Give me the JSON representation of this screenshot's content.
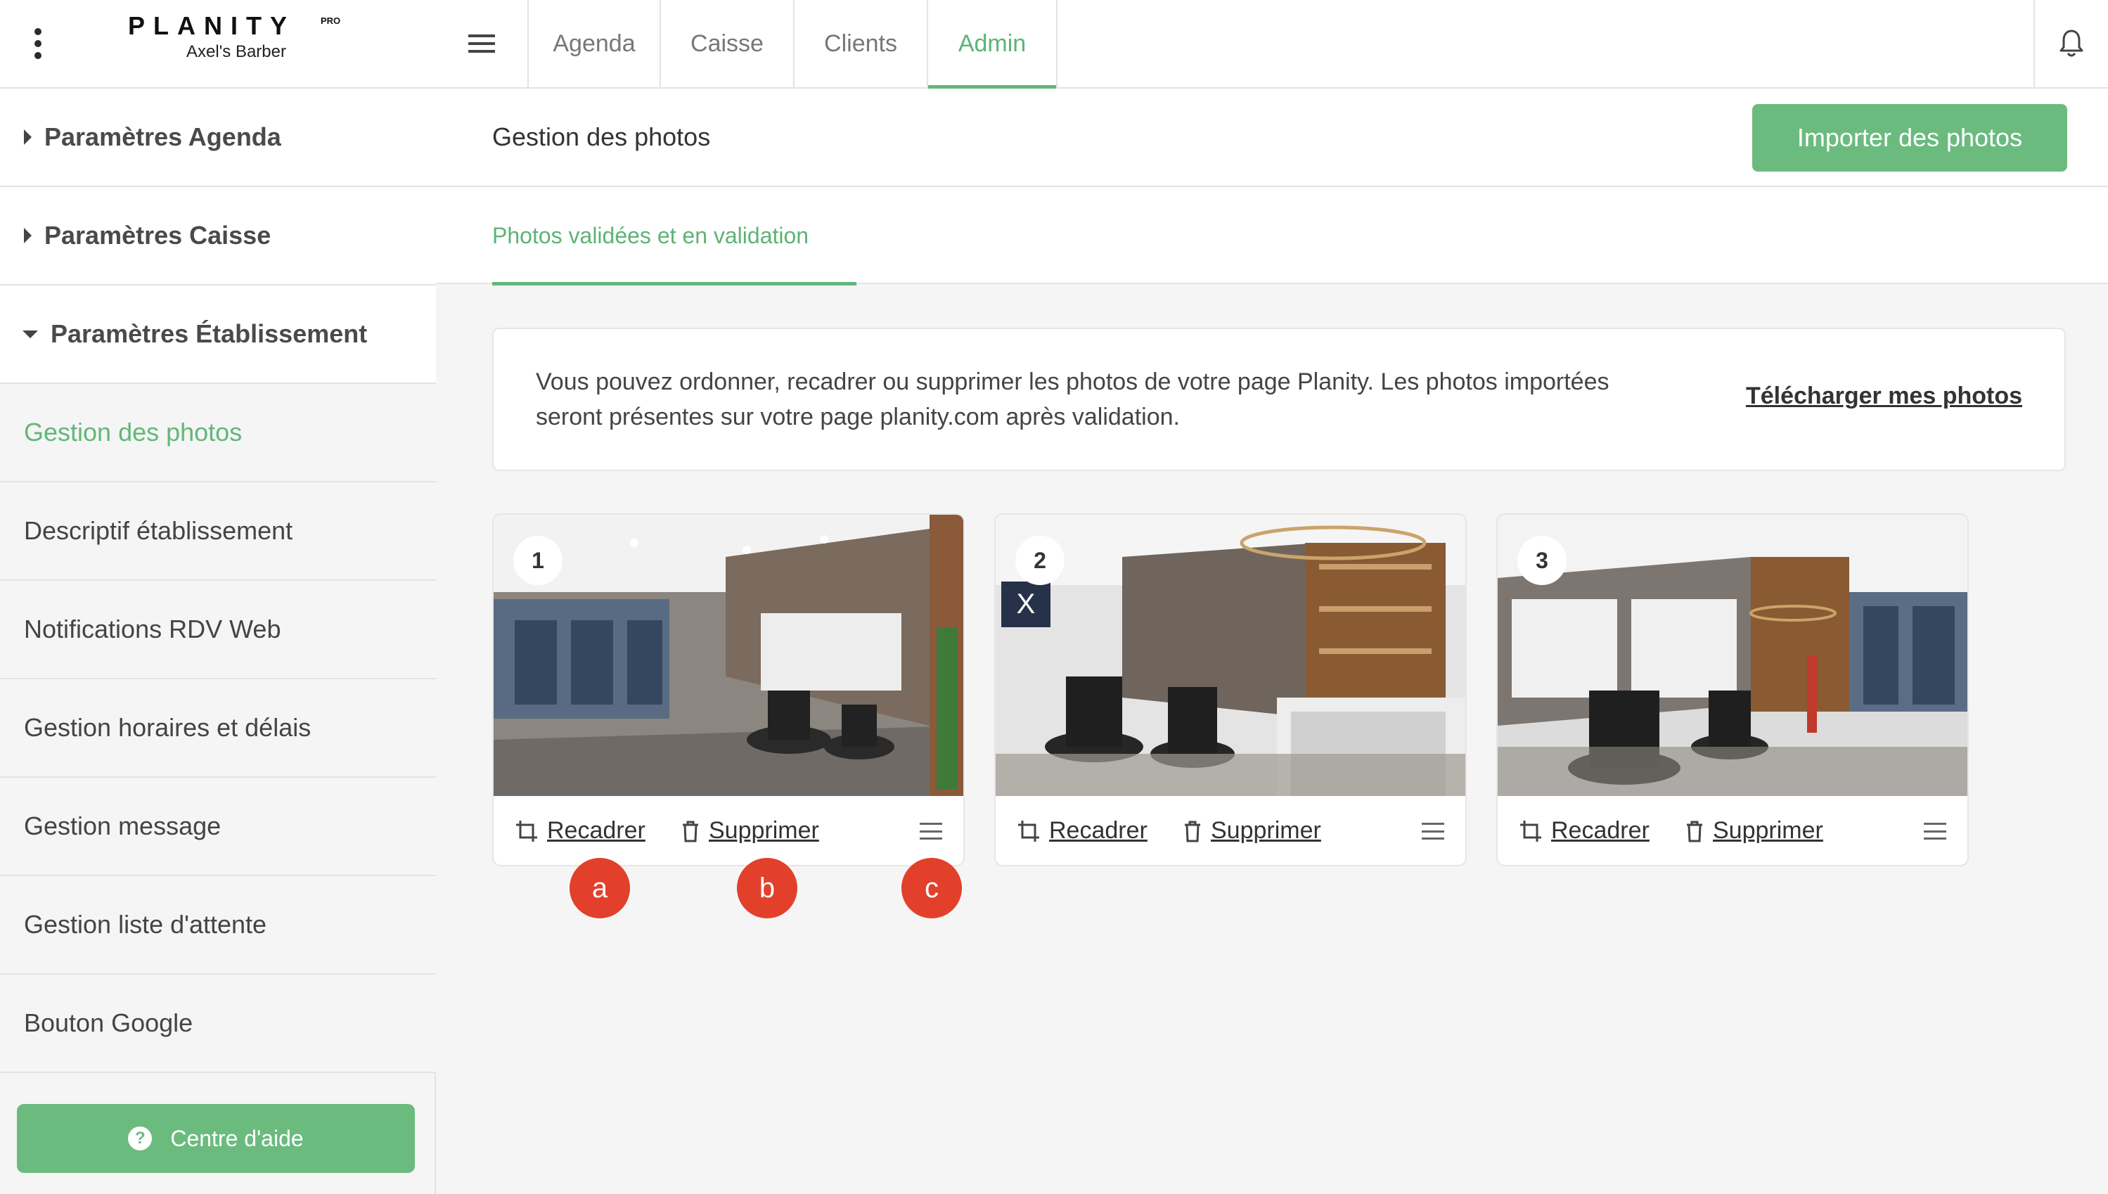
{
  "brand": {
    "logo": "PLANITY",
    "logo_badge": "PRO",
    "salon": "Axel's Barber"
  },
  "topnav": {
    "tabs": [
      {
        "label": "Agenda",
        "active": false
      },
      {
        "label": "Caisse",
        "active": false
      },
      {
        "label": "Clients",
        "active": false
      },
      {
        "label": "Admin",
        "active": true
      }
    ]
  },
  "sidebar": {
    "sections": [
      {
        "label": "Paramètres Agenda",
        "expanded": false
      },
      {
        "label": "Paramètres Caisse",
        "expanded": false
      },
      {
        "label": "Paramètres Établissement",
        "expanded": true
      }
    ],
    "items": [
      {
        "label": "Gestion des photos",
        "active": true
      },
      {
        "label": "Descriptif établissement",
        "active": false
      },
      {
        "label": "Notifications RDV Web",
        "active": false
      },
      {
        "label": "Gestion horaires et délais",
        "active": false
      },
      {
        "label": "Gestion message",
        "active": false
      },
      {
        "label": "Gestion liste d'attente",
        "active": false
      },
      {
        "label": "Bouton Google",
        "active": false
      }
    ],
    "help_button": "Centre d'aide"
  },
  "main": {
    "title": "Gestion des photos",
    "import_button": "Importer des photos",
    "subtab": "Photos validées et en validation",
    "info_text": "Vous pouvez ordonner, recadrer ou supprimer les photos de votre page Planity. Les photos importées seront présentes sur votre page planity.com après validation.",
    "download_link": "Télécharger mes photos"
  },
  "photos": [
    {
      "number": "1",
      "crop_label": "Recadrer",
      "delete_label": "Supprimer"
    },
    {
      "number": "2",
      "crop_label": "Recadrer",
      "delete_label": "Supprimer"
    },
    {
      "number": "3",
      "crop_label": "Recadrer",
      "delete_label": "Supprimer"
    }
  ],
  "annotations": [
    {
      "label": "a",
      "target": "crop-button"
    },
    {
      "label": "b",
      "target": "delete-button"
    },
    {
      "label": "c",
      "target": "reorder-handle"
    }
  ],
  "colors": {
    "accent": "#62b77a",
    "button": "#6bbb7f",
    "marker": "#e2402a",
    "background": "#f5f5f5"
  },
  "icons": [
    "more-vertical-icon",
    "menu-icon",
    "bell-icon",
    "help-icon",
    "crop-icon",
    "trash-icon",
    "drag-handle-icon"
  ]
}
